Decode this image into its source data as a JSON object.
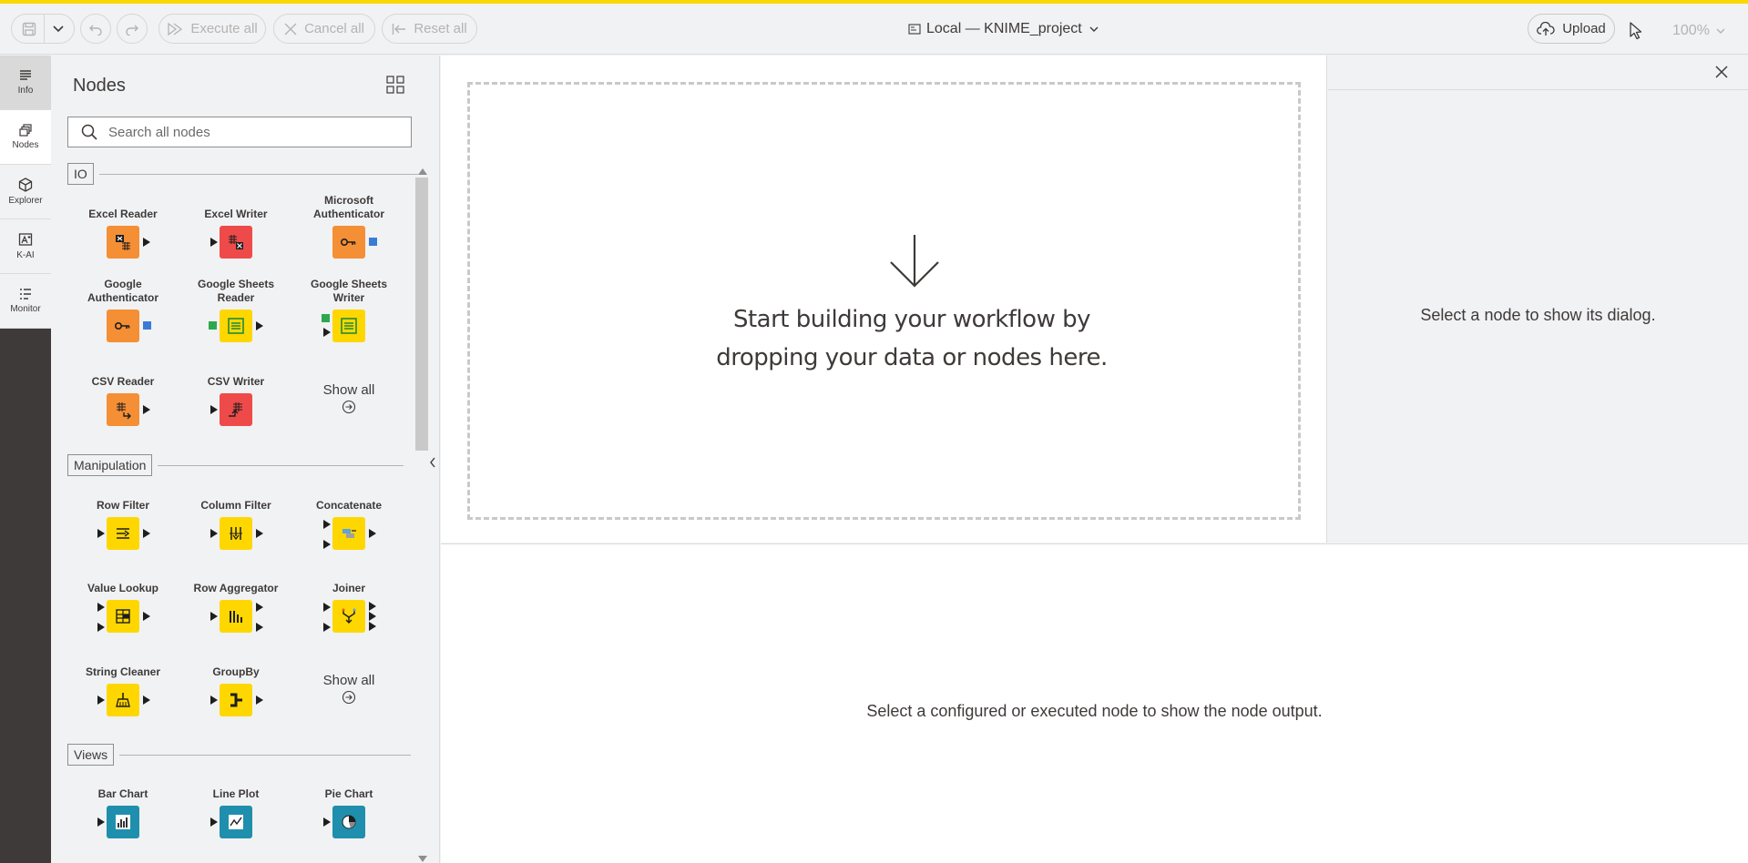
{
  "toolbar": {
    "execute_all": "Execute all",
    "cancel_all": "Cancel all",
    "reset_all": "Reset all",
    "project_title": "Local — KNIME_project",
    "upload": "Upload",
    "zoom": "100%"
  },
  "rail": {
    "items": [
      {
        "label": "Info",
        "icon": "info-icon"
      },
      {
        "label": "Nodes",
        "icon": "nodes-icon"
      },
      {
        "label": "Explorer",
        "icon": "explorer-icon"
      },
      {
        "label": "K-AI",
        "icon": "k-ai-icon"
      },
      {
        "label": "Monitor",
        "icon": "monitor-icon"
      }
    ]
  },
  "nodes_panel": {
    "title": "Nodes",
    "search_placeholder": "Search all nodes",
    "show_all": "Show all",
    "sections": [
      {
        "name": "IO",
        "nodes": [
          {
            "label": "Excel Reader",
            "color": "#f58f35"
          },
          {
            "label": "Excel Writer",
            "color": "#ef4a4a"
          },
          {
            "label": "Microsoft Authenticator",
            "color": "#f58f35"
          },
          {
            "label": "Google Authenticator",
            "color": "#f58f35"
          },
          {
            "label": "Google Sheets Reader",
            "color": "#ffd700"
          },
          {
            "label": "Google Sheets Writer",
            "color": "#ffd700"
          },
          {
            "label": "CSV Reader",
            "color": "#f58f35"
          },
          {
            "label": "CSV Writer",
            "color": "#ef4a4a"
          }
        ]
      },
      {
        "name": "Manipulation",
        "nodes": [
          {
            "label": "Row Filter",
            "color": "#ffd700"
          },
          {
            "label": "Column Filter",
            "color": "#ffd700"
          },
          {
            "label": "Concatenate",
            "color": "#ffd700"
          },
          {
            "label": "Value Lookup",
            "color": "#ffd700"
          },
          {
            "label": "Row Aggregator",
            "color": "#ffd700"
          },
          {
            "label": "Joiner",
            "color": "#ffd700"
          },
          {
            "label": "String Cleaner",
            "color": "#ffd700"
          },
          {
            "label": "GroupBy",
            "color": "#ffd700"
          }
        ]
      },
      {
        "name": "Views",
        "nodes": [
          {
            "label": "Bar Chart",
            "color": "#1f8fad"
          },
          {
            "label": "Line Plot",
            "color": "#1f8fad"
          },
          {
            "label": "Pie Chart",
            "color": "#1f8fad"
          }
        ]
      }
    ]
  },
  "canvas": {
    "drop_message": "Start building your workflow by dropping your data or nodes here."
  },
  "dialog": {
    "message": "Select a node to show its dialog."
  },
  "output": {
    "message": "Select a configured or executed node to show the node output."
  },
  "colors": {
    "accent": "#fcd800",
    "io_orange": "#f58f35",
    "io_red": "#ef4a4a",
    "manipulation_yellow": "#ffd700",
    "views_blue": "#1f8fad"
  }
}
